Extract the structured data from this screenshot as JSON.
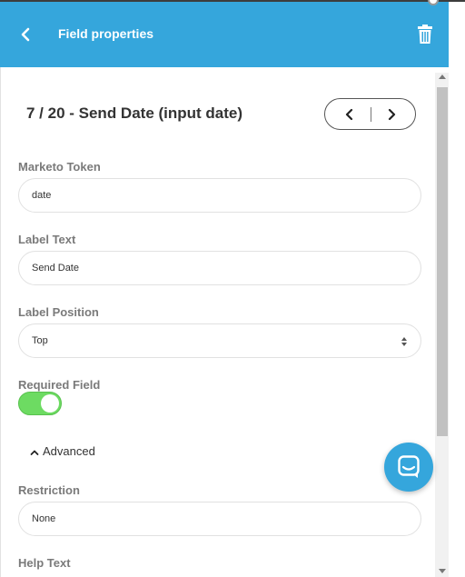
{
  "header": {
    "title": "Field properties"
  },
  "field": {
    "heading": "7 / 20 - Send Date (input date)"
  },
  "form": {
    "marketo_token": {
      "label": "Marketo Token",
      "value": "date"
    },
    "label_text": {
      "label": "Label Text",
      "value": "Send Date"
    },
    "label_position": {
      "label": "Label Position",
      "value": "Top"
    },
    "required": {
      "label": "Required Field",
      "enabled": true
    },
    "advanced": {
      "label": "Advanced"
    },
    "restriction": {
      "label": "Restriction",
      "value": "None"
    },
    "help_text": {
      "label": "Help Text"
    }
  },
  "icons": [
    "back-icon",
    "trash-icon",
    "chevron-left-icon",
    "chevron-right-icon",
    "chevron-up-icon",
    "chat-icon"
  ],
  "colors": {
    "header": "#35a6dc",
    "toggle_on": "#6ddb62"
  }
}
